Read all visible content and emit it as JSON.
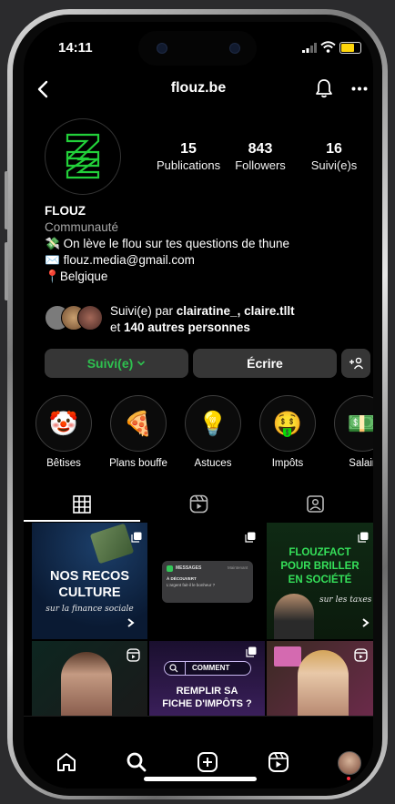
{
  "status": {
    "time": "14:11"
  },
  "header": {
    "title": "flouz.be"
  },
  "profile": {
    "stats": [
      {
        "value": "15",
        "label": "Publications"
      },
      {
        "value": "843",
        "label": "Followers"
      },
      {
        "value": "16",
        "label": "Suivi(e)s"
      }
    ],
    "name": "FLOUZ",
    "category": "Communauté",
    "bio_lines": [
      {
        "emoji": "💸",
        "text": "On lève le flou sur tes questions de thune"
      },
      {
        "emoji": "✉️",
        "text": "flouz.media@gmail.com"
      },
      {
        "emoji": "📍",
        "text": "Belgique"
      }
    ],
    "followed_by": {
      "prefix": "Suivi(e) par ",
      "names": "clairatine_, claire.tllt",
      "line2_prefix": "et ",
      "others": "140 autres personnes"
    }
  },
  "actions": {
    "following_label": "Suivi(e)",
    "message_label": "Écrire",
    "accent": "#2ec04f"
  },
  "highlights": [
    {
      "emoji": "🤡",
      "name": "Bêtises"
    },
    {
      "emoji": "🍕",
      "name": "Plans bouffe"
    },
    {
      "emoji": "💡",
      "name": "Astuces"
    },
    {
      "emoji": "🤑",
      "name": "Impôts"
    },
    {
      "emoji": "💵",
      "name": "Salair"
    }
  ],
  "tabs": [
    "grid-icon",
    "reels-icon",
    "tagged-icon"
  ],
  "posts": [
    {
      "lines": [
        "NOS RECOS",
        "CULTURE"
      ],
      "sub": "sur la finance sociale"
    },
    {
      "app": "MESSAGES",
      "time": "Maintenant",
      "title": "À DÉCOUVERT",
      "body": "L'argent fait-il le bonheur ?"
    },
    {
      "lines": [
        "FLOUZFACT",
        "POUR BRILLER",
        "EN SOCIÉTÉ"
      ],
      "sub": "sur les taxes"
    },
    {
      "kind": "portrait"
    },
    {
      "tag": "COMMENT",
      "lines": [
        "REMPLIR SA",
        "FICHE D'IMPÔTS ?"
      ]
    },
    {
      "kind": "portrait"
    }
  ]
}
